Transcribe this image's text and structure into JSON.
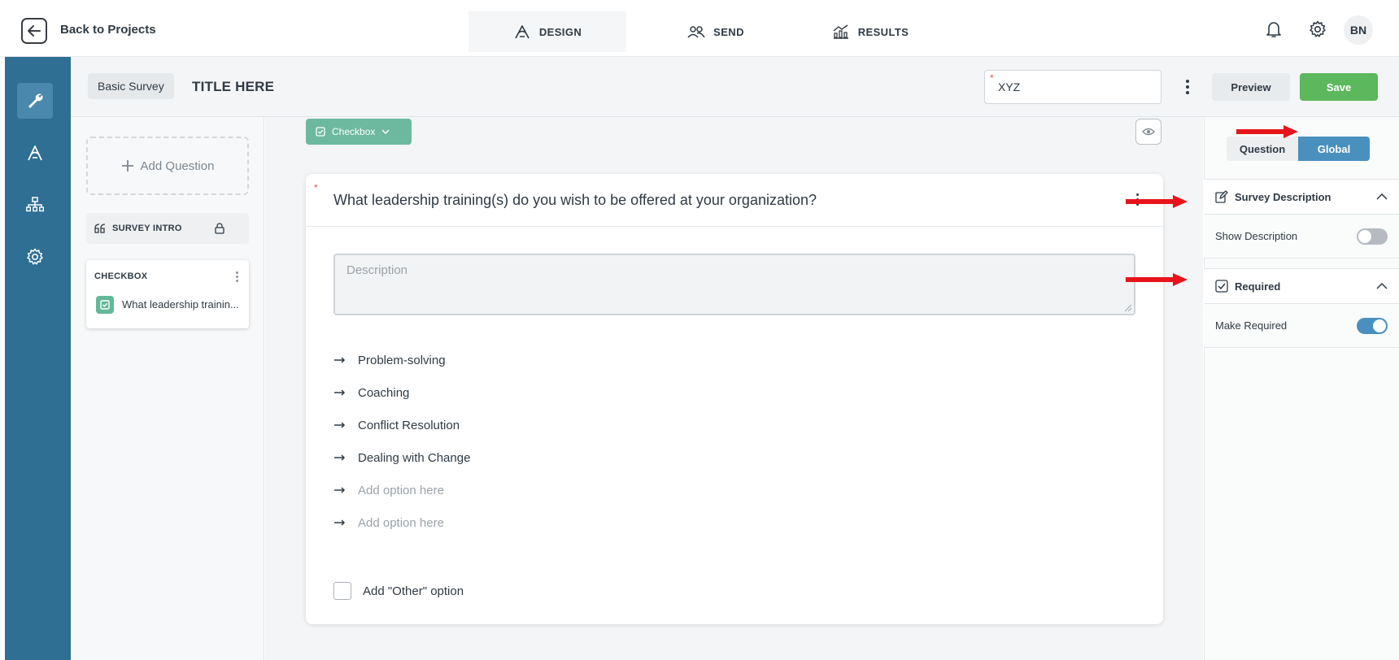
{
  "topbar": {
    "back_label": "Back to Projects",
    "tabs": [
      {
        "label": "DESIGN",
        "icon": "design-icon",
        "active": true
      },
      {
        "label": "SEND",
        "icon": "users-icon",
        "active": false
      },
      {
        "label": "RESULTS",
        "icon": "chart-icon",
        "active": false
      }
    ],
    "avatar_initials": "BN"
  },
  "rail": {
    "items": [
      {
        "icon": "wrench-icon",
        "active": true
      },
      {
        "icon": "design-icon",
        "active": false
      },
      {
        "icon": "sitemap-icon",
        "active": false
      },
      {
        "icon": "gear-icon",
        "active": false
      }
    ]
  },
  "subheader": {
    "survey_type": "Basic Survey",
    "survey_title": "TITLE HERE",
    "name_value": "XYZ",
    "preview_label": "Preview",
    "save_label": "Save"
  },
  "question_list": {
    "add_label": "Add Question",
    "intro_label": "SURVEY INTRO",
    "card_type": "CHECKBOX",
    "card_text": "What leadership trainin..."
  },
  "editor": {
    "type_chip": "Checkbox",
    "question_text": "What leadership training(s) do you wish to be offered at your organization?",
    "description_placeholder": "Description",
    "options": [
      "Problem-solving",
      "Coaching",
      "Conflict Resolution",
      "Dealing with Change"
    ],
    "option_placeholders": [
      "Add option here",
      "Add option here"
    ],
    "other_label": "Add \"Other\" option"
  },
  "settings": {
    "tabs": [
      "Question",
      "Global"
    ],
    "active_tab": "Global",
    "sections": [
      {
        "title": "Survey Description",
        "icon": "edit-icon",
        "row_label": "Show Description",
        "toggle_on": false
      },
      {
        "title": "Required",
        "icon": "checkbox-icon",
        "row_label": "Make Required",
        "toggle_on": true
      }
    ]
  },
  "colors": {
    "rail": "#2f6f94",
    "primary": "#4a90be",
    "save": "#5cb85c",
    "chip": "#6db9a0",
    "annotation": "#e8141b"
  }
}
